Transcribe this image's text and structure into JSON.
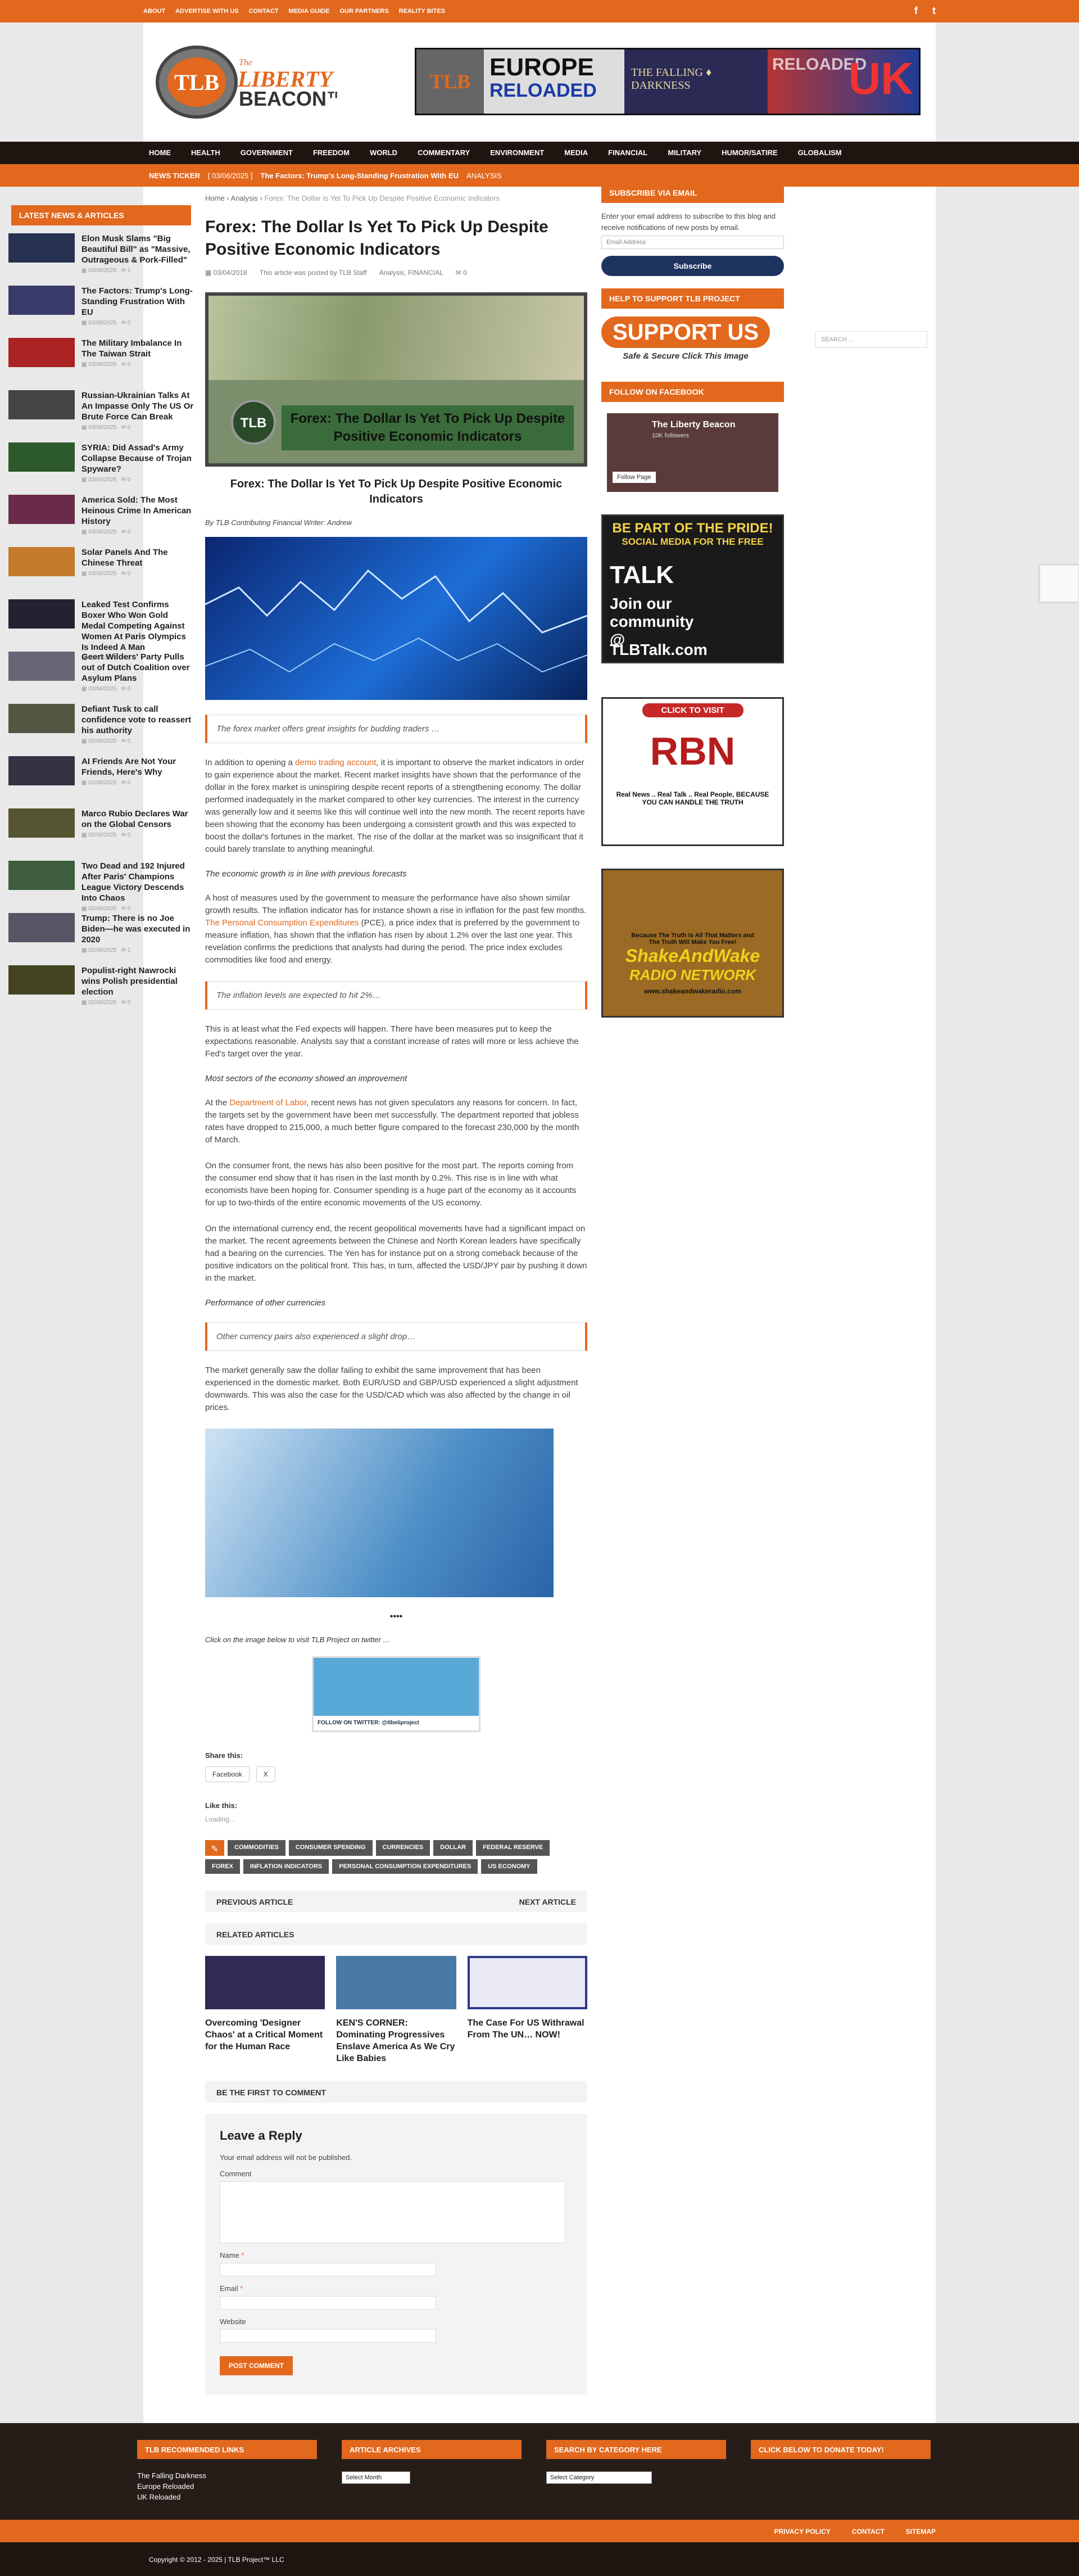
{
  "topbar": {
    "links": [
      "ABOUT",
      "ADVERTISE WITH US",
      "CONTACT",
      "MEDIA GUIDE",
      "OUR PARTNERS",
      "REALITY BITES"
    ],
    "social": [
      "f",
      "t"
    ]
  },
  "logo": {
    "mark": "TLB",
    "line1": "The",
    "line2": "LIBERTY",
    "line3": "BEACON™"
  },
  "banner": {
    "left": "EUROPE",
    "right": "RELOADED",
    "mid": "THE FALLING ♦ DARKNESS",
    "tlb": "TLB",
    "uk": "UK",
    "reloaded": "RELOADED"
  },
  "nav": [
    "HOME",
    "HEALTH",
    "GOVERNMENT",
    "FREEDOM",
    "WORLD",
    "COMMENTARY",
    "ENVIRONMENT",
    "MEDIA",
    "FINANCIAL",
    "MILITARY",
    "HUMOR/SATIRE",
    "GLOBALISM"
  ],
  "ticker": {
    "label": "NEWS TICKER",
    "date": "[ 03/06/2025 ]",
    "headline": "The Factors: Trump's Long-Standing Frustration With EU",
    "cat": "ANALYSIS",
    "search_placeholder": "SEARCH ..."
  },
  "left": {
    "title": "LATEST NEWS & ARTICLES",
    "items": [
      {
        "t": "Elon Musk Slams \"Big Beautiful Bill\" as \"Massive, Outrageous & Pork-Filled\"",
        "d": "03/06/2025",
        "c": "1"
      },
      {
        "t": "The Factors: Trump's Long-Standing Frustration With EU",
        "d": "03/06/2025",
        "c": "0"
      },
      {
        "t": "The Military Imbalance In The Taiwan Strait",
        "d": "03/06/2025",
        "c": "0"
      },
      {
        "t": "Russian-Ukrainian Talks At An Impasse Only The US Or Brute Force Can Break",
        "d": "03/06/2025",
        "c": "0"
      },
      {
        "t": "SYRIA: Did Assad's Army Collapse Because of Trojan Spyware?",
        "d": "03/06/2025",
        "c": "0"
      },
      {
        "t": "America Sold: The Most Heinous Crime In American History",
        "d": "03/06/2025",
        "c": "0"
      },
      {
        "t": "Solar Panels And The Chinese Threat",
        "d": "03/06/2025",
        "c": "0"
      },
      {
        "t": "Leaked Test Confirms Boxer Who Won Gold Medal Competing Against Women At Paris Olympics Is Indeed A Man",
        "d": "03/06/2025",
        "c": "0"
      },
      {
        "t": "Geert Wilders' Party Pulls out of Dutch Coalition over Asylum Plans",
        "d": "03/06/2025",
        "c": "0"
      },
      {
        "t": "Defiant Tusk to call confidence vote to reassert his authority",
        "d": "02/06/2025",
        "c": "0"
      },
      {
        "t": "AI Friends Are Not Your Friends, Here's Why",
        "d": "02/06/2025",
        "c": "0"
      },
      {
        "t": "Marco Rubio Declares War on the Global Censors",
        "d": "02/06/2025",
        "c": "0"
      },
      {
        "t": "Two Dead and 192 Injured After Paris' Champions League Victory Descends Into Chaos",
        "d": "02/06/2025",
        "c": "0"
      },
      {
        "t": "Trump: There is no Joe Biden—he was executed in 2020",
        "d": "02/06/2025",
        "c": "1"
      },
      {
        "t": "Populist-right Nawrocki wins Polish presidential election",
        "d": "02/06/2025",
        "c": "0"
      }
    ]
  },
  "article": {
    "crumbs": [
      "Home",
      "Analysis",
      "Forex: The Dollar Is Yet To Pick Up Despite Positive Economic Indicators"
    ],
    "title": "Forex: The Dollar Is Yet To Pick Up Despite Positive Economic Indicators",
    "date": "03/04/2018",
    "author": "This article was posted by TLB Staff",
    "cats": "Analysis, FINANCIAL",
    "comments": "0",
    "img_text": "Forex: The Dollar Is Yet To Pick Up Despite Positive Economic Indicators",
    "caption": "Forex: The Dollar Is Yet To Pick Up Despite Positive Economic Indicators",
    "byline": "By TLB Contributing Financial Writer: Andrew",
    "q1": "The forex market offers great insights for budding traders …",
    "p1a": "In addition to opening a ",
    "p1link": "demo trading account",
    "p1b": ", it is important to observe the market indicators in order to gain experience about the market. Recent market insights have shown that the performance of the dollar in the forex market is uninspiring despite recent reports of a strengthening economy. The dollar performed inadequately in the market compared to other key currencies. The interest in the currency was generally low and it seems like this will continue well into the new month. The recent reports have been showing that the economy has been undergoing a consistent growth and this was expected to boost the dollar's fortunes in the market. The rise of the dollar at the market was so insignificant that it could barely translate to anything meaningful.",
    "h1": "The economic growth is in line with previous forecasts",
    "p2": "A host of measures used by the government to measure the performance have also shown similar growth results. The inflation indicator has for instance shown a rise in inflation for the past few months.",
    "p3link": "The Personal Consumption Expenditures",
    "p3": " (PCE), a price index that is preferred by the government to measure inflation, has shown that the inflation has risen by about 1.2% over the last one year. This revelation confirms the predictions that analysts had during the period. The price index excludes commodities like food and energy.",
    "q2": "The inflation levels are expected to hit 2%…",
    "p4": "This is at least what the Fed expects will happen. There have been measures put to keep the expectations reasonable. Analysts say that a constant increase of rates will more or less achieve the Fed's target over the year.",
    "h2": "Most sectors of the economy showed an improvement",
    "p5a": "At the ",
    "p5link": "Department of Labor",
    "p5b": ", recent news has not given speculators any reasons for concern. In fact, the targets set by the government have been met successfully. The department reported that jobless rates have dropped to 215,000, a much better figure compared to the forecast 230,000 by the month of March.",
    "p6": "On the consumer front, the news has also been positive for the most part. The reports coming from the consumer end show that it has risen in the last month by 0.2%. This rise is in line with what economists have been hoping for. Consumer spending is a huge part of the economy as it accounts for up to two-thirds of the entire economic movements of the US economy.",
    "p7": "On the international currency end, the recent geopolitical movements have had a significant impact on the market. The recent agreements between the Chinese and North Korean leaders have specifically had a bearing on the currencies. The Yen has for instance put on a strong comeback because of the positive indicators on the political front. This has, in turn, affected the USD/JPY pair by pushing it down in the market.",
    "h3": "Performance of other currencies",
    "q3": "Other currency pairs also experienced a slight drop…",
    "p8": "The market generally saw the dollar failing to exhibit the same improvement that has been experienced in the domestic market. Both EUR/USD and GBP/USD experienced a slight adjustment downwards. This was also the case for the USD/CAD which was also affected by the change in oil prices.",
    "stars": "••••",
    "twnote": "Click on the image below to visit TLB Project on twitter …",
    "twbanner": "FOLLOW ON TWITTER: @tlbeliproject",
    "share": "Share this:",
    "fb": "Facebook",
    "x": "X",
    "like": "Like this:",
    "loading": "Loading...",
    "tags": [
      "COMMODITIES",
      "CONSUMER SPENDING",
      "CURRENCIES",
      "DOLLAR",
      "FEDERAL RESERVE",
      "FOREX",
      "INFLATION INDICATORS",
      "PERSONAL CONSUMPTION EXPENDITURES",
      "US ECONOMY"
    ],
    "prev": "PREVIOUS ARTICLE",
    "next": "NEXT ARTICLE",
    "related": "RELATED ARTICLES",
    "rel": [
      "Overcoming 'Designer Chaos' at a Critical Moment for the Human Race",
      "KEN'S CORNER: Dominating Progressives Enslave America As We Cry Like Babies",
      "The Case For US Withrawal From The UN… NOW!"
    ],
    "first": "BE THE FIRST TO COMMENT",
    "reply": {
      "title": "Leave a Reply",
      "note": "Your email address will not be published.",
      "comment": "Comment",
      "name": "Name",
      "email": "Email",
      "website": "Website",
      "star": "*",
      "post": "POST COMMENT"
    }
  },
  "right": {
    "sub_title": "SUBSCRIBE VIA EMAIL",
    "sub_text": "Enter your email address to subscribe to this blog and receive notifications of new posts by email.",
    "email_ph": "Email Address",
    "sub_btn": "Subscribe",
    "help_title": "HELP TO SUPPORT TLB PROJECT",
    "support": "SUPPORT US",
    "support2": "Safe & Secure  Click This Image",
    "follow_title": "FOLLOW ON FACEBOOK",
    "fb_name": "The Liberty Beacon",
    "fb_follow": "Follow Page",
    "fb_followers": "10K followers",
    "talk1": "BE PART OF THE PRIDE!",
    "talk2": "SOCIAL MEDIA FOR THE FREE",
    "talk3": "Join our community @",
    "talk4": "TLBTalk.com",
    "talk_logo": "TALK",
    "rbn_click": "CLICK TO VISIT",
    "rbn": "RBN",
    "rbn_tag": "Real News .. Real Talk .. Real People, BECAUSE YOU CAN HANDLE THE TRUTH",
    "sw1": "Because The Truth Is All That Matters and The Truth Will Make You Free!",
    "sw2": "ShakeAndWake",
    "sw3": "RADIO NETWORK",
    "sw4": "www.shakeandwakeradio.com"
  },
  "footer": {
    "h1": "TLB RECOMMENDED LINKS",
    "h2": "ARTICLE ARCHIVES",
    "h3": "SEARCH BY CATEGORY HERE",
    "h4": "CLICK BELOW TO DONATE TODAY!",
    "links": [
      "The Falling Darkness",
      "Europe Reloaded",
      "UK Reloaded"
    ],
    "month": "Select Month",
    "cat": "Select Category",
    "bar": [
      "PRIVACY POLICY",
      "CONTACT",
      "SITEMAP"
    ],
    "copy": "Copyright © 2012 - 2025 | TLB Project™ LLC"
  },
  "colors": {
    "accent": "#e2681e",
    "dark": "#1e1511",
    "navy": "#1f3360"
  }
}
